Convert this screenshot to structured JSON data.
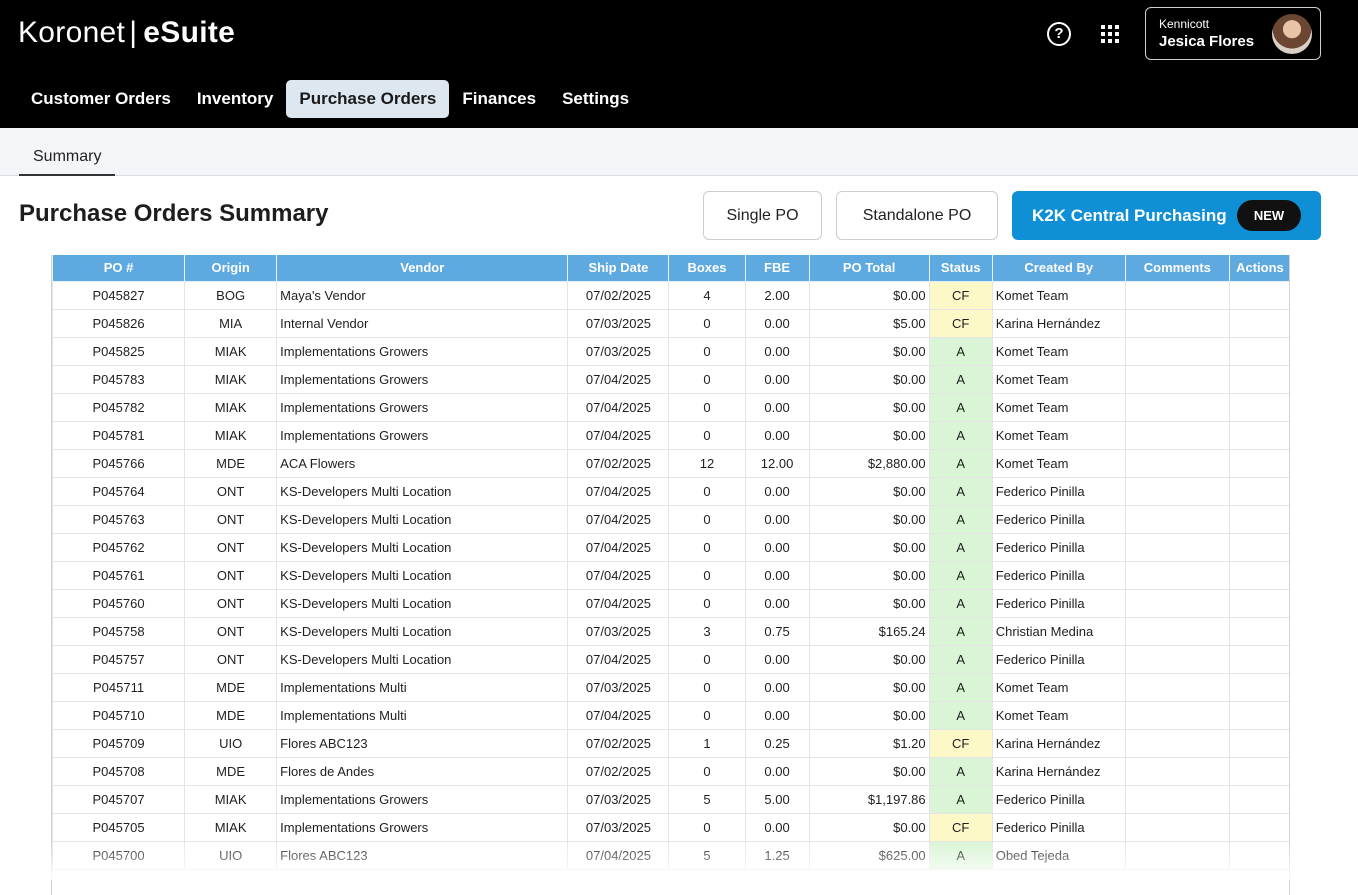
{
  "header": {
    "brand": "Koronet",
    "separator": "|",
    "suite": "eSuite",
    "help_icon": "help-circle-icon",
    "apps_icon": "apps-grid-icon",
    "user": {
      "company": "Kennicott",
      "name": "Jesica Flores"
    }
  },
  "nav": {
    "items": [
      "Customer Orders",
      "Inventory",
      "Purchase Orders",
      "Finances",
      "Settings"
    ],
    "active": "Purchase Orders"
  },
  "subnav": {
    "tab": "Summary"
  },
  "page": {
    "title": "Purchase Orders Summary",
    "buttons": {
      "single_po": "Single PO",
      "standalone_po": "Standalone PO",
      "k2k": "K2K Central Purchasing",
      "new_badge": "NEW"
    }
  },
  "colors": {
    "header_bg": "#000000",
    "table_header": "#5ea9e0",
    "primary_button": "#0e8fd6",
    "status_cf": "#fdf8c8",
    "status_a": "#d9f5d5"
  },
  "table": {
    "columns": [
      "PO #",
      "Origin",
      "Vendor",
      "Ship Date",
      "Boxes",
      "FBE",
      "PO Total",
      "Status",
      "Created By",
      "Comments",
      "Actions"
    ],
    "rows": [
      {
        "po": "P045827",
        "origin": "BOG",
        "vendor": "Maya's Vendor",
        "ship_date": "07/02/2025",
        "boxes": "4",
        "fbe": "2.00",
        "total": "$0.00",
        "status": "CF",
        "created_by": "Komet Team"
      },
      {
        "po": "P045826",
        "origin": "MIA",
        "vendor": "Internal Vendor",
        "ship_date": "07/03/2025",
        "boxes": "0",
        "fbe": "0.00",
        "total": "$5.00",
        "status": "CF",
        "created_by": "Karina Hernández"
      },
      {
        "po": "P045825",
        "origin": "MIAK",
        "vendor": "Implementations Growers",
        "ship_date": "07/03/2025",
        "boxes": "0",
        "fbe": "0.00",
        "total": "$0.00",
        "status": "A",
        "created_by": "Komet Team"
      },
      {
        "po": "P045783",
        "origin": "MIAK",
        "vendor": "Implementations Growers",
        "ship_date": "07/04/2025",
        "boxes": "0",
        "fbe": "0.00",
        "total": "$0.00",
        "status": "A",
        "created_by": "Komet Team"
      },
      {
        "po": "P045782",
        "origin": "MIAK",
        "vendor": "Implementations Growers",
        "ship_date": "07/04/2025",
        "boxes": "0",
        "fbe": "0.00",
        "total": "$0.00",
        "status": "A",
        "created_by": "Komet Team"
      },
      {
        "po": "P045781",
        "origin": "MIAK",
        "vendor": "Implementations Growers",
        "ship_date": "07/04/2025",
        "boxes": "0",
        "fbe": "0.00",
        "total": "$0.00",
        "status": "A",
        "created_by": "Komet Team"
      },
      {
        "po": "P045766",
        "origin": "MDE",
        "vendor": "ACA Flowers",
        "ship_date": "07/02/2025",
        "boxes": "12",
        "fbe": "12.00",
        "total": "$2,880.00",
        "status": "A",
        "created_by": "Komet Team"
      },
      {
        "po": "P045764",
        "origin": "ONT",
        "vendor": "KS-Developers Multi Location",
        "ship_date": "07/04/2025",
        "boxes": "0",
        "fbe": "0.00",
        "total": "$0.00",
        "status": "A",
        "created_by": "Federico Pinilla"
      },
      {
        "po": "P045763",
        "origin": "ONT",
        "vendor": "KS-Developers Multi Location",
        "ship_date": "07/04/2025",
        "boxes": "0",
        "fbe": "0.00",
        "total": "$0.00",
        "status": "A",
        "created_by": "Federico Pinilla"
      },
      {
        "po": "P045762",
        "origin": "ONT",
        "vendor": "KS-Developers Multi Location",
        "ship_date": "07/04/2025",
        "boxes": "0",
        "fbe": "0.00",
        "total": "$0.00",
        "status": "A",
        "created_by": "Federico Pinilla"
      },
      {
        "po": "P045761",
        "origin": "ONT",
        "vendor": "KS-Developers Multi Location",
        "ship_date": "07/04/2025",
        "boxes": "0",
        "fbe": "0.00",
        "total": "$0.00",
        "status": "A",
        "created_by": "Federico Pinilla"
      },
      {
        "po": "P045760",
        "origin": "ONT",
        "vendor": "KS-Developers Multi Location",
        "ship_date": "07/04/2025",
        "boxes": "0",
        "fbe": "0.00",
        "total": "$0.00",
        "status": "A",
        "created_by": "Federico Pinilla"
      },
      {
        "po": "P045758",
        "origin": "ONT",
        "vendor": "KS-Developers Multi Location",
        "ship_date": "07/03/2025",
        "boxes": "3",
        "fbe": "0.75",
        "total": "$165.24",
        "status": "A",
        "created_by": "Christian Medina"
      },
      {
        "po": "P045757",
        "origin": "ONT",
        "vendor": "KS-Developers Multi Location",
        "ship_date": "07/04/2025",
        "boxes": "0",
        "fbe": "0.00",
        "total": "$0.00",
        "status": "A",
        "created_by": "Federico Pinilla"
      },
      {
        "po": "P045711",
        "origin": "MDE",
        "vendor": "Implementations Multi",
        "ship_date": "07/03/2025",
        "boxes": "0",
        "fbe": "0.00",
        "total": "$0.00",
        "status": "A",
        "created_by": "Komet Team"
      },
      {
        "po": "P045710",
        "origin": "MDE",
        "vendor": "Implementations Multi",
        "ship_date": "07/04/2025",
        "boxes": "0",
        "fbe": "0.00",
        "total": "$0.00",
        "status": "A",
        "created_by": "Komet Team"
      },
      {
        "po": "P045709",
        "origin": "UIO",
        "vendor": "Flores ABC123",
        "ship_date": "07/02/2025",
        "boxes": "1",
        "fbe": "0.25",
        "total": "$1.20",
        "status": "CF",
        "created_by": "Karina Hernández"
      },
      {
        "po": "P045708",
        "origin": "MDE",
        "vendor": "Flores de Andes",
        "ship_date": "07/02/2025",
        "boxes": "0",
        "fbe": "0.00",
        "total": "$0.00",
        "status": "A",
        "created_by": "Karina Hernández"
      },
      {
        "po": "P045707",
        "origin": "MIAK",
        "vendor": "Implementations Growers",
        "ship_date": "07/03/2025",
        "boxes": "5",
        "fbe": "5.00",
        "total": "$1,197.86",
        "status": "A",
        "created_by": "Federico Pinilla"
      },
      {
        "po": "P045705",
        "origin": "MIAK",
        "vendor": "Implementations Growers",
        "ship_date": "07/03/2025",
        "boxes": "0",
        "fbe": "0.00",
        "total": "$0.00",
        "status": "CF",
        "created_by": "Federico Pinilla"
      },
      {
        "po": "P045700",
        "origin": "UIO",
        "vendor": "Flores ABC123",
        "ship_date": "07/04/2025",
        "boxes": "5",
        "fbe": "1.25",
        "total": "$625.00",
        "status": "A",
        "created_by": "Obed Tejeda"
      }
    ]
  }
}
